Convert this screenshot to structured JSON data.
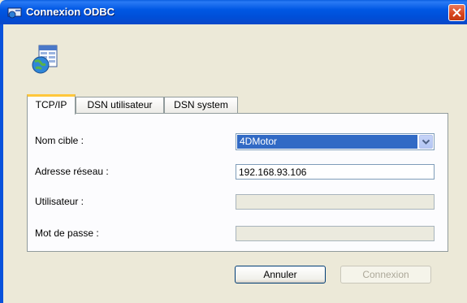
{
  "window": {
    "title": "Connexion ODBC",
    "icon": "odbc-database-icon",
    "close_icon": "close-x-icon"
  },
  "tabs": [
    {
      "label": "TCP/IP",
      "active": true
    },
    {
      "label": "DSN utilisateur",
      "active": false
    },
    {
      "label": "DSN system",
      "active": false
    }
  ],
  "form": {
    "target_label": "Nom cible :",
    "target_value": "4DMotor",
    "address_label": "Adresse réseau :",
    "address_value": "192.168.93.106",
    "user_label": "Utilisateur :",
    "user_value": "",
    "password_label": "Mot de passe :",
    "password_value": ""
  },
  "buttons": {
    "cancel": "Annuler",
    "connect": "Connexion"
  },
  "colors": {
    "titlebar": "#0057e3",
    "selection": "#316ac5",
    "active_tab_accent": "#ffc73c",
    "close_button": "#d8431c"
  }
}
